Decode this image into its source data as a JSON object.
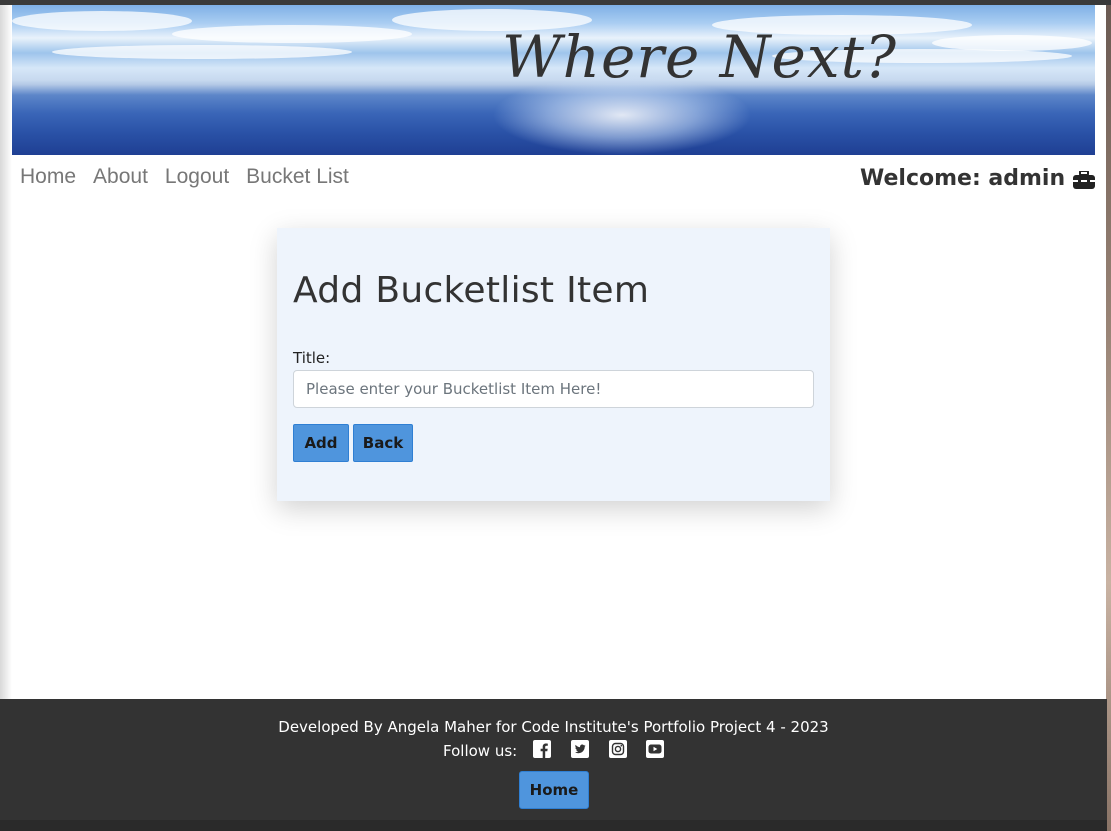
{
  "banner": {
    "title": "Where Next?"
  },
  "nav": {
    "items": [
      {
        "label": "Home"
      },
      {
        "label": "About"
      },
      {
        "label": "Logout"
      },
      {
        "label": "Bucket List"
      }
    ],
    "welcome": "Welcome: admin",
    "icon": "toolbox-icon"
  },
  "form": {
    "heading": "Add Bucketlist Item",
    "title_label": "Title:",
    "title_value": "",
    "title_placeholder": "Please enter your Bucketlist Item Here!",
    "add_label": "Add",
    "back_label": "Back"
  },
  "footer": {
    "credit": "Developed By Angela Maher for Code Institute's Portfolio Project 4 - 2023",
    "follow": "Follow us:",
    "social_icons": [
      "facebook-icon",
      "twitter-icon",
      "instagram-icon",
      "youtube-icon"
    ],
    "home_label": "Home"
  },
  "colors": {
    "button": "#4f95dd",
    "footer_bg": "#333333",
    "card_bg": "#eef4fc"
  }
}
